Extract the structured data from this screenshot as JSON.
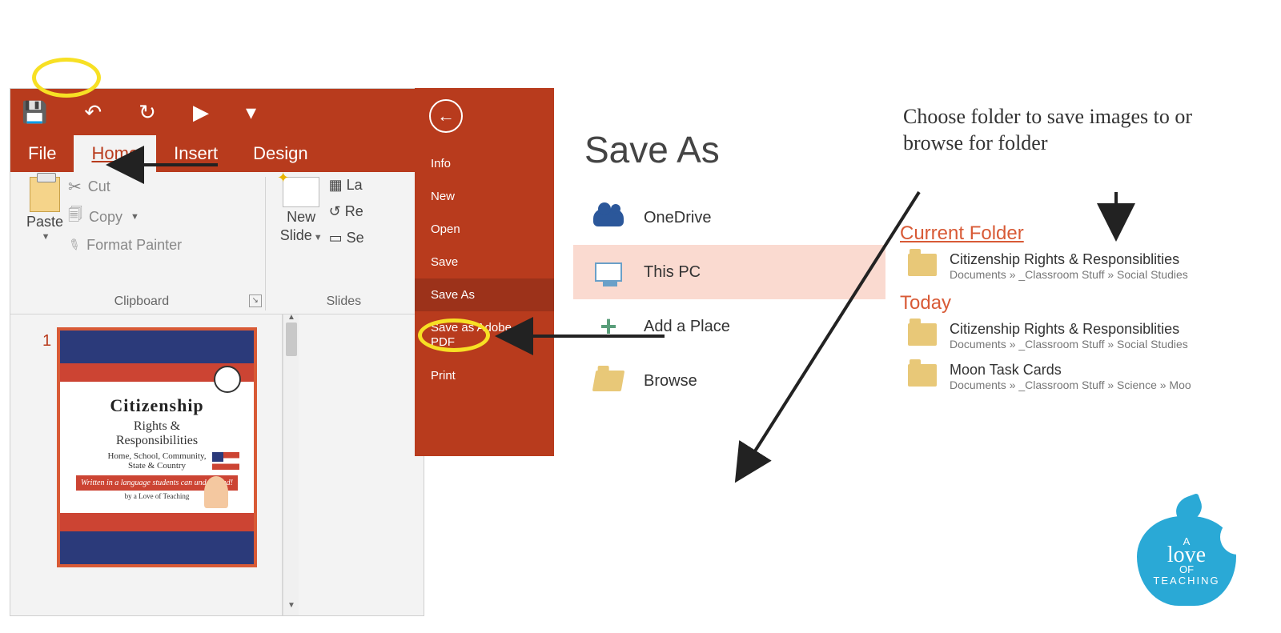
{
  "qat": {
    "save": "💾",
    "undo": "↶",
    "redo": "↻",
    "present": "▶",
    "more": "▾"
  },
  "tabs": {
    "file": "File",
    "home": "Home",
    "insert": "Insert",
    "design": "Design"
  },
  "clipboard": {
    "paste": "Paste",
    "cut": "Cut",
    "copy": "Copy",
    "format_painter": "Format Painter",
    "group_label": "Clipboard"
  },
  "slides": {
    "new_slide_line1": "New",
    "new_slide_line2": "Slide",
    "layout_trunc": "La",
    "reset_trunc": "Re",
    "section_trunc": "Se",
    "group_label": "Slides"
  },
  "thumbnail": {
    "number": "1",
    "title": "Citizenship",
    "subtitle": "Rights &\nResponsibilities",
    "tagline": "Home, School, Community,\nState & Country",
    "band": "Written in a language students can understand!",
    "credit": "by a Love of Teaching"
  },
  "backstage": {
    "back": "←",
    "items": [
      "Info",
      "New",
      "Open",
      "Save",
      "Save As",
      "Save as Adobe PDF",
      "Print"
    ],
    "selected_index": 4
  },
  "saveas": {
    "title": "Save As",
    "locations": [
      {
        "icon": "cloud",
        "label": "OneDrive"
      },
      {
        "icon": "pc",
        "label": "This PC",
        "selected": true
      },
      {
        "icon": "plus",
        "label": "Add a Place"
      },
      {
        "icon": "folder",
        "label": "Browse"
      }
    ],
    "current_header": "Current Folder",
    "today_header": "Today",
    "folders": {
      "current": {
        "name": "Citizenship Rights & Responsiblities",
        "path": "Documents » _Classroom Stuff » Social Studies"
      },
      "today": [
        {
          "name": "Citizenship Rights & Responsiblities",
          "path": "Documents » _Classroom Stuff » Social Studies"
        },
        {
          "name": "Moon Task Cards",
          "path": "Documents » _Classroom Stuff » Science » Moo"
        }
      ]
    }
  },
  "annotation": "Choose folder to save images to or browse for folder",
  "logo": {
    "line1": "A",
    "love": "love",
    "line2": "OF",
    "line3": "TEACHING"
  }
}
